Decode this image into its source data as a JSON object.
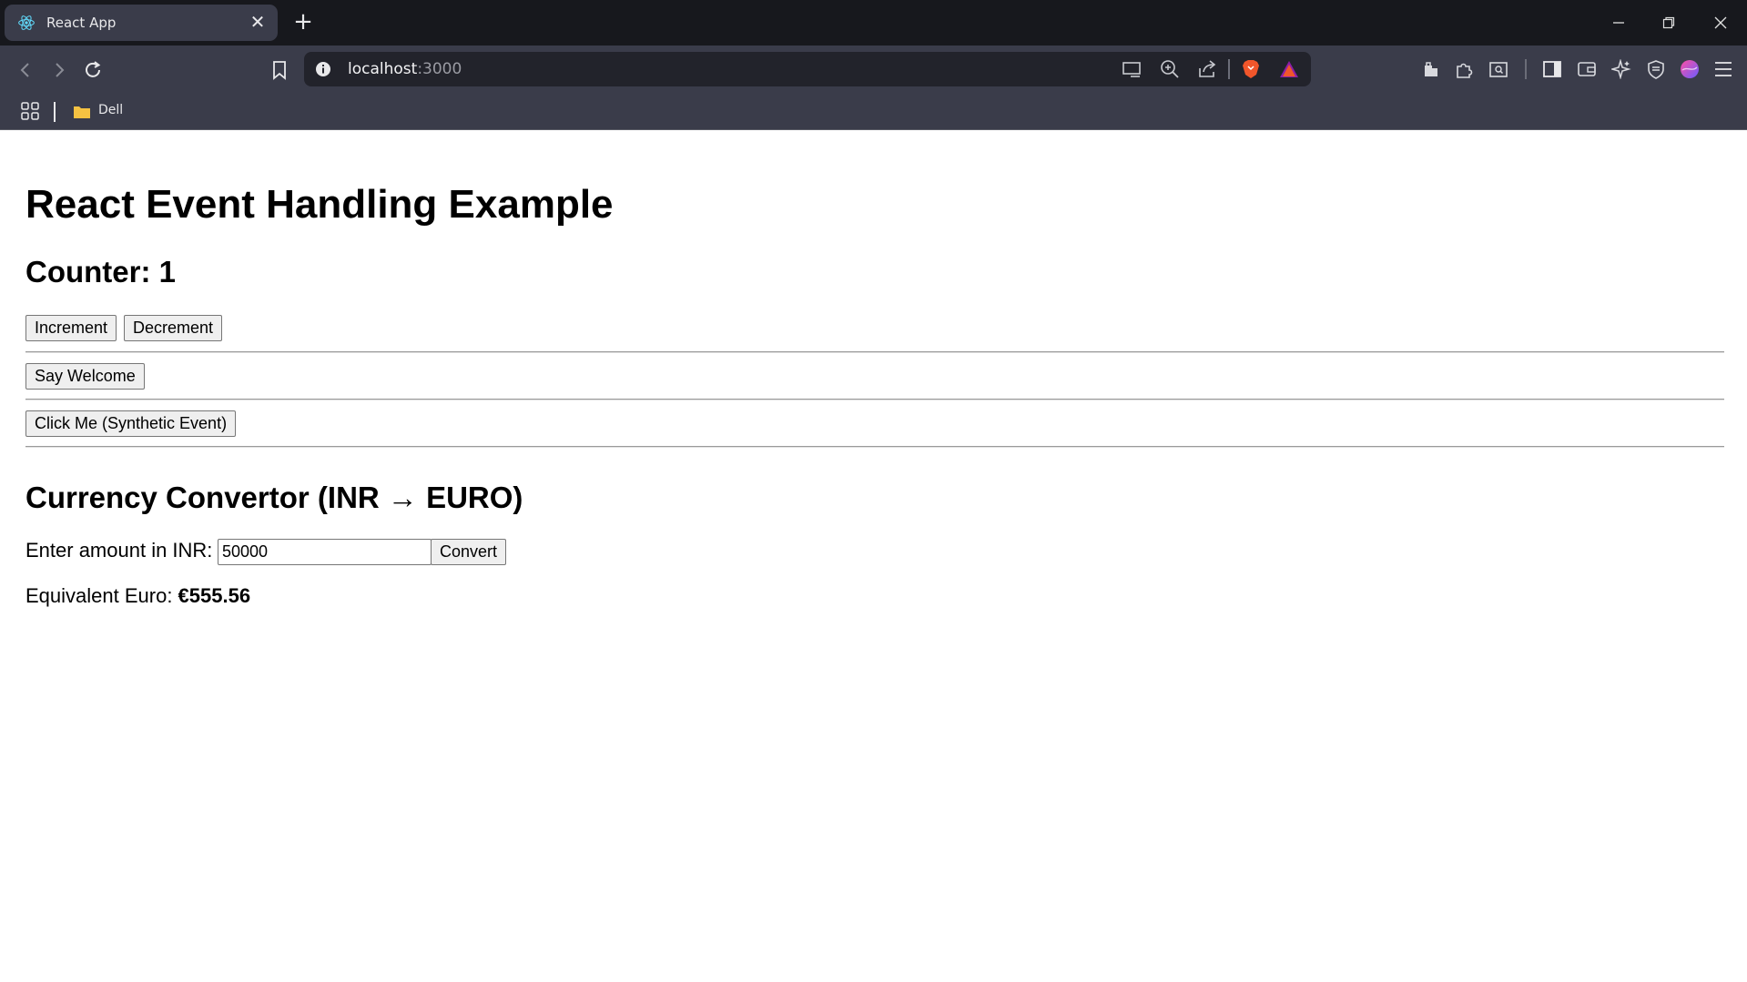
{
  "browser": {
    "tab": {
      "title": "React App",
      "favicon": "react-logo-icon",
      "close_glyph": "✕"
    },
    "new_tab_glyph": "+",
    "address": {
      "host": "localhost",
      "port": ":3000"
    },
    "bookmarks": [
      {
        "label": "Dell",
        "icon": "folder-icon"
      }
    ],
    "colors": {
      "titlebar": "#17181d",
      "toolbar": "#3a3c4a",
      "urlbar": "#22232b"
    }
  },
  "page": {
    "heading": "React Event Handling Example",
    "counter_label": "Counter: 1",
    "buttons": {
      "increment": "Increment",
      "decrement": "Decrement",
      "welcome": "Say Welcome",
      "synthetic": "Click Me (Synthetic Event)"
    },
    "currency": {
      "heading": "Currency Convertor (INR → EURO)",
      "input_label": "Enter amount in INR:",
      "input_value": "50000",
      "convert_button": "Convert",
      "result_label": "Equivalent Euro: ",
      "result_value": "€555.56"
    }
  }
}
